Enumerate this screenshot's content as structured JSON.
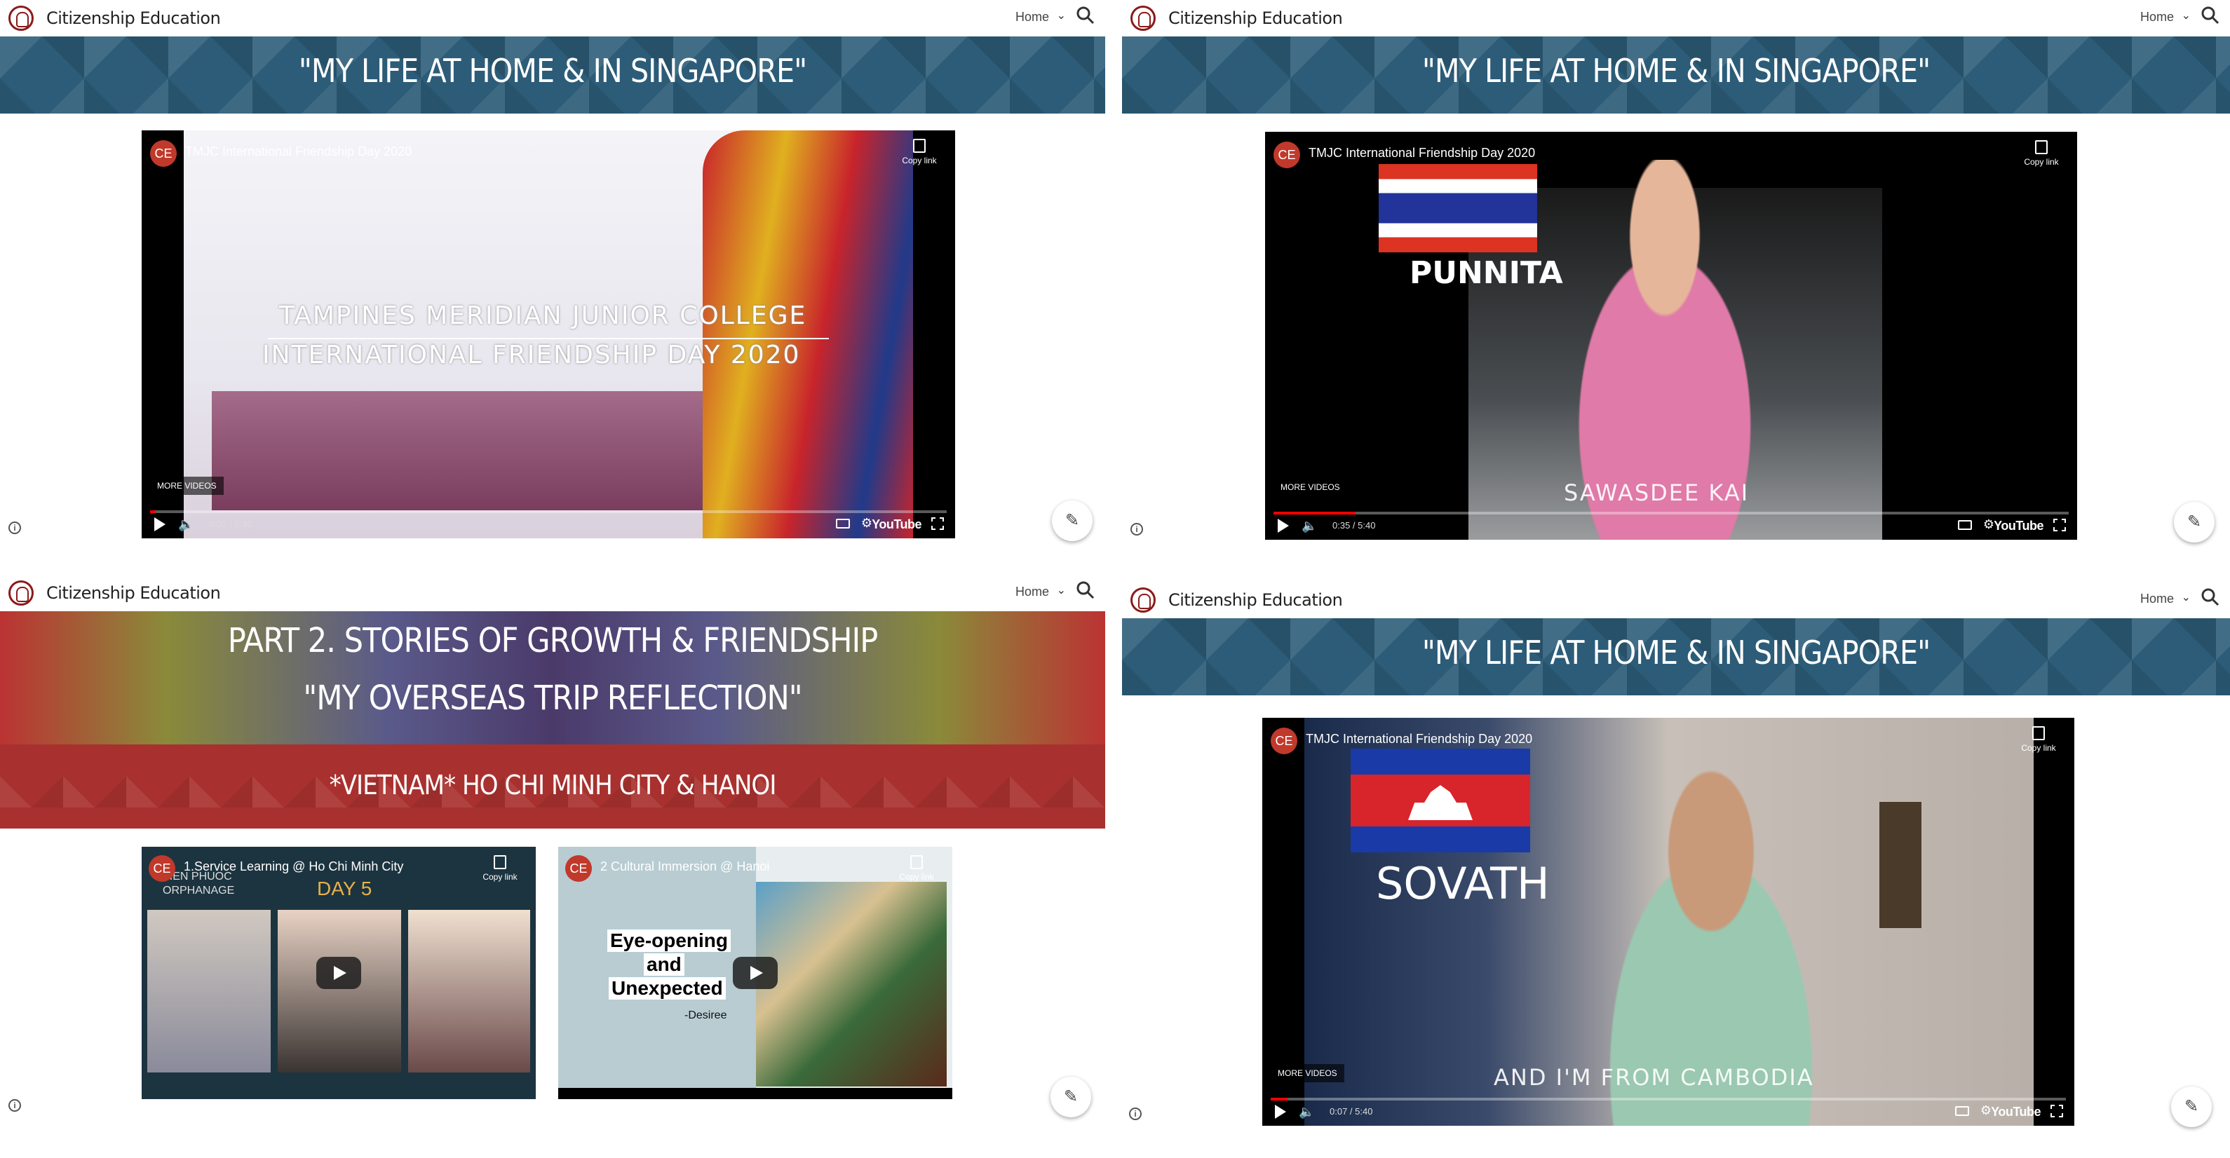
{
  "site": {
    "title": "Citizenship Education",
    "nav_home": "Home"
  },
  "panels": [
    {
      "banner": "\"MY LIFE AT HOME & IN SINGAPORE\"",
      "video": {
        "channel": "CE",
        "title": "TMJC International Friendship Day 2020",
        "copy_link": "Copy link",
        "overlay_line1": "TAMPINES MERIDIAN JUNIOR COLLEGE",
        "overlay_line2": "INTERNATIONAL FRIENDSHIP DAY 2020",
        "more_videos": "MORE VIDEOS",
        "time": "0:02 / 5:40",
        "progress": 0.006,
        "yt": "YouTube"
      }
    },
    {
      "banner": "\"MY LIFE AT HOME & IN SINGAPORE\"",
      "video": {
        "channel": "CE",
        "title": "TMJC International Friendship Day 2020",
        "copy_link": "Copy link",
        "name": "PUNNITA",
        "subtitle": "SAWASDEE KAI",
        "more_videos": "MORE VIDEOS",
        "time": "0:35 / 5:40",
        "progress": 0.103,
        "yt": "YouTube"
      }
    },
    {
      "banner_line1": "PART 2. STORIES OF GROWTH & FRIENDSHIP",
      "banner_line2": "\"MY OVERSEAS TRIP REFLECTION\"",
      "banner_line3": "*VIETNAM* HO CHI MINH CITY & HANOI",
      "videos": [
        {
          "channel": "CE",
          "title": "1.Service Learning @ Ho Chi Minh City",
          "copy_link": "Copy link",
          "tag1": "TIEN PHUOC",
          "tag2": "ORPHANAGE",
          "day": "DAY 5"
        },
        {
          "channel": "CE",
          "title": "2 Cultural Immersion @ Hanoi",
          "copy_link": "Copy link",
          "quote1": "Eye-opening",
          "quote2": "and",
          "quote3": "Unexpected",
          "author": "-Desiree"
        }
      ]
    },
    {
      "banner": "\"MY LIFE AT HOME & IN SINGAPORE\"",
      "video": {
        "channel": "CE",
        "title": "TMJC International Friendship Day 2020",
        "copy_link": "Copy link",
        "name": "SOVATH",
        "subtitle": "AND I'M FROM CAMBODIA",
        "more_videos": "MORE VIDEOS",
        "time": "0:07 / 5:40",
        "progress": 0.021,
        "yt": "YouTube"
      }
    }
  ],
  "colors": {
    "banner_blue": "#2c5c78",
    "banner_red": "#a8312f",
    "accent_red": "#c0392b"
  },
  "icons": [
    "search-icon",
    "chevron-down-icon",
    "copy-icon",
    "play-icon",
    "volume-icon",
    "captions-icon",
    "settings-icon",
    "fullscreen-icon",
    "info-icon",
    "pencil-icon"
  ]
}
